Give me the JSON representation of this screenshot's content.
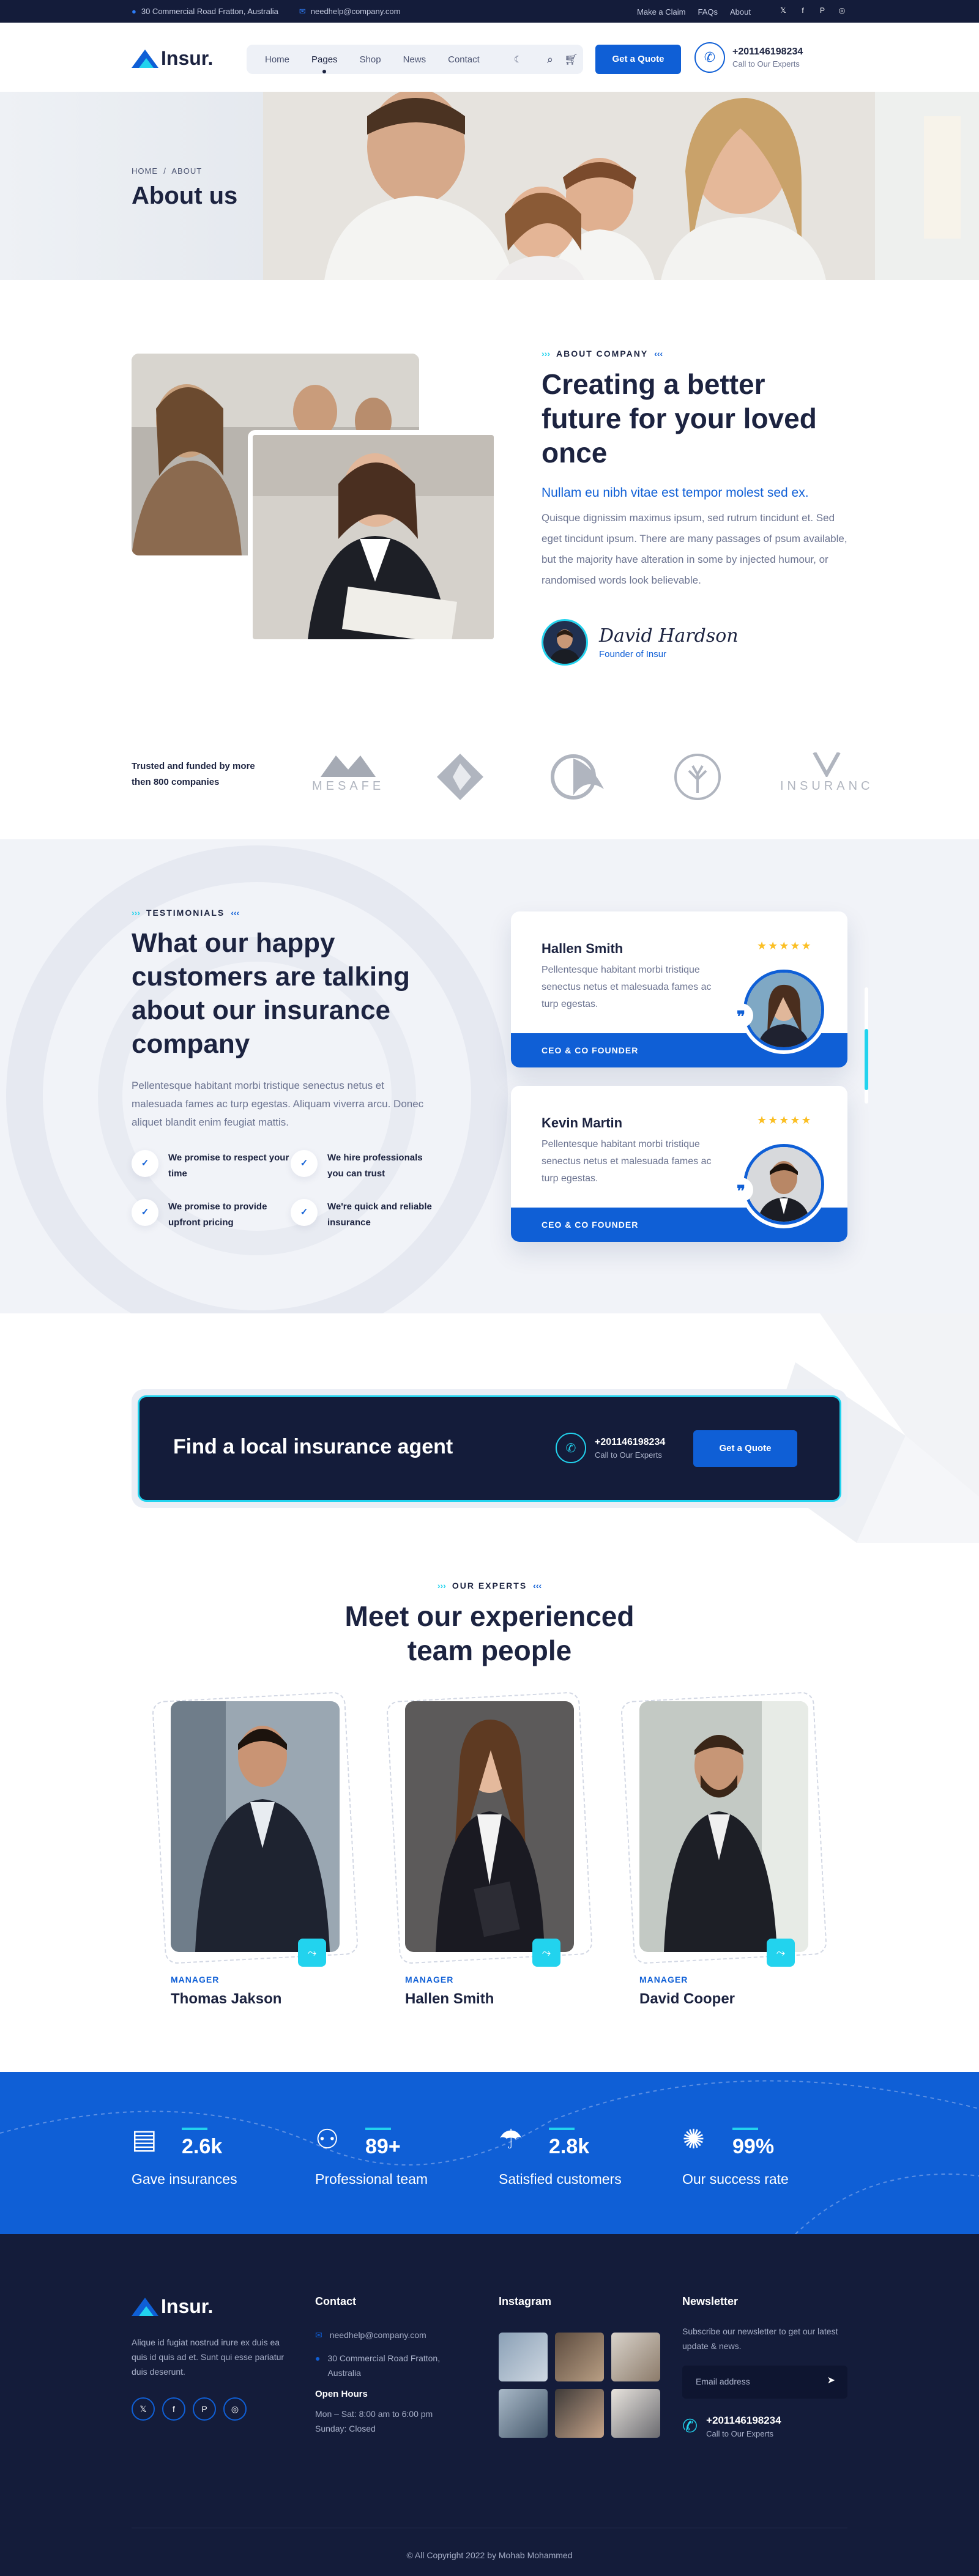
{
  "topbar": {
    "address": "30 Commercial Road Fratton, Australia",
    "email": "needhelp@company.com",
    "links": [
      "Make a Claim",
      "FAQs",
      "About"
    ],
    "social": [
      "twitter-icon",
      "facebook-icon",
      "pinterest-icon",
      "instagram-icon"
    ]
  },
  "header": {
    "logo": "Insur.",
    "nav": [
      "Home",
      "Pages",
      "Shop",
      "News",
      "Contact"
    ],
    "active_nav": "Pages",
    "quote_button": "Get a Quote",
    "phone": "+201146198234",
    "phone_sub": "Call to Our Experts"
  },
  "hero": {
    "breadcrumb_home": "HOME",
    "breadcrumb_sep": "/",
    "breadcrumb_current": "ABOUT",
    "title": "About us"
  },
  "about": {
    "eyebrow": "ABOUT COMPANY",
    "title": "Creating a better future for your loved once",
    "lead": "Nullam eu nibh vitae est tempor molest sed ex.",
    "body": "Quisque dignissim maximus ipsum, sed rutrum tincidunt et. Sed eget tincidunt ipsum. There are many passages of psum available, but the majority have alteration in some by injected humour, or randomised words look believable.",
    "signature": "David Hardson",
    "role": "Founder of Insur"
  },
  "partners": {
    "label": "Trusted and funded by more then 800 companies",
    "logos": [
      "MESAFE",
      "",
      "",
      "",
      "INSURANC"
    ]
  },
  "testimonials": {
    "eyebrow": "TESTIMONIALS",
    "title": "What our happy customers are talking about our insurance company",
    "body": "Pellentesque habitant morbi tristique senectus netus et malesuada fames ac turp egestas. Aliquam viverra arcu. Donec aliquet blandit enim feugiat mattis.",
    "features": [
      "We promise to respect your time",
      "We hire professionals you can trust",
      "We promise to provide upfront pricing",
      "We're quick and reliable insurance"
    ],
    "cards": [
      {
        "name": "Hallen Smith",
        "quote": "Pellentesque habitant morbi tristique senectus netus et malesuada fames ac turp egestas.",
        "role": "CEO & CO FOUNDER",
        "rating": 5
      },
      {
        "name": "Kevin Martin",
        "quote": "Pellentesque habitant morbi tristique senectus netus et malesuada fames ac turp egestas.",
        "role": "CEO & CO FOUNDER",
        "rating": 5
      }
    ]
  },
  "agent": {
    "title": "Find a local insurance agent",
    "phone": "+201146198234",
    "phone_sub": "Call to Our Experts",
    "button": "Get a Quote"
  },
  "team": {
    "eyebrow": "OUR EXPERTS",
    "title": "Meet our experienced team people",
    "members": [
      {
        "role": "MANAGER",
        "name": "Thomas Jakson"
      },
      {
        "role": "MANAGER",
        "name": "Hallen Smith"
      },
      {
        "role": "MANAGER",
        "name": "David Cooper"
      }
    ]
  },
  "stats": [
    {
      "value": "2.6k",
      "label": "Gave insurances",
      "icon": "insurance-doc-icon"
    },
    {
      "value": "89+",
      "label": "Professional team",
      "icon": "team-icon"
    },
    {
      "value": "2.8k",
      "label": "Satisfied customers",
      "icon": "customers-icon"
    },
    {
      "value": "99%",
      "label": "Our success rate",
      "icon": "success-icon"
    }
  ],
  "footer": {
    "logo": "Insur.",
    "about": "Alique id fugiat nostrud irure ex duis ea quis id quis ad et. Sunt qui esse pariatur duis deserunt.",
    "contact_title": "Contact",
    "email": "needhelp@company.com",
    "address": "30 Commercial Road Fratton, Australia",
    "hours_title": "Open Hours",
    "hours_1": "Mon – Sat: 8:00 am to 6:00 pm",
    "hours_2": "Sunday: Closed",
    "instagram_title": "Instagram",
    "newsletter_title": "Newsletter",
    "newsletter_text": "Subscribe our newsletter to get our latest update & news.",
    "email_placeholder": "Email address",
    "phone": "+201146198234",
    "phone_sub": "Call to Our Experts",
    "copyright": "© All Copyright 2022 by Mohab Mohammed"
  },
  "colors": {
    "primary": "#0f5fd6",
    "accent": "#22d3ee",
    "dark": "#141c3a"
  }
}
